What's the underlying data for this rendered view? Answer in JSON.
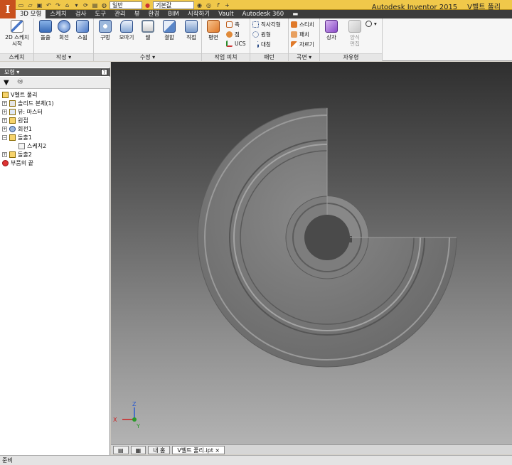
{
  "app": {
    "product": "Autodesk Inventor 2015",
    "document": "V벨트 풀리"
  },
  "quick_access": {
    "style_value": "일반",
    "material_value": "기본값"
  },
  "tabs": [
    "3D 모형",
    "스케치",
    "검사",
    "도구",
    "관리",
    "뷰",
    "환경",
    "BIM",
    "시작하기",
    "Vault",
    "Autodesk 360"
  ],
  "ribbon": {
    "panels": {
      "sketch": "스케치",
      "create": "작성",
      "modify": "수정",
      "work_features": "작업 피쳐",
      "pattern": "패턴",
      "surface": "곡면",
      "freeform": "자유형"
    },
    "buttons": {
      "start_sketch_1": "2D 스케치",
      "start_sketch_2": "시작",
      "extrude": "돌출",
      "revolve": "회전",
      "sweep": "스윕",
      "hole": "구멍",
      "fillet": "모따기",
      "shell": "쉘",
      "combine": "결합",
      "direct": "직접",
      "plane": "평면",
      "axis": "축",
      "point": "점",
      "ucs": "UCS",
      "rect_pattern": "직사각형",
      "circ_pattern": "원형",
      "mirror": "대칭",
      "stitch": "스티치",
      "patch": "패치",
      "trim": "자르기",
      "box": "상자",
      "edit_form_1": "양식",
      "edit_form_2": "편집"
    }
  },
  "browser": {
    "title": "모형",
    "items": [
      {
        "label": "V벨트 풀리"
      },
      {
        "label": "솔리드 본체(1)"
      },
      {
        "label": "뷰: 마스터"
      },
      {
        "label": "원점"
      },
      {
        "label": "회전1"
      },
      {
        "label": "돌출1"
      },
      {
        "label": "스케치2"
      },
      {
        "label": "돌출2"
      },
      {
        "label": "부품의 끝"
      }
    ]
  },
  "viewport": {
    "axis_x": "X",
    "axis_y": "Y",
    "axis_z": "Z"
  },
  "doc_tabs": {
    "home": "내 홈",
    "file": "V벨트 풀리.ipt"
  },
  "status": {
    "text": "준비"
  }
}
